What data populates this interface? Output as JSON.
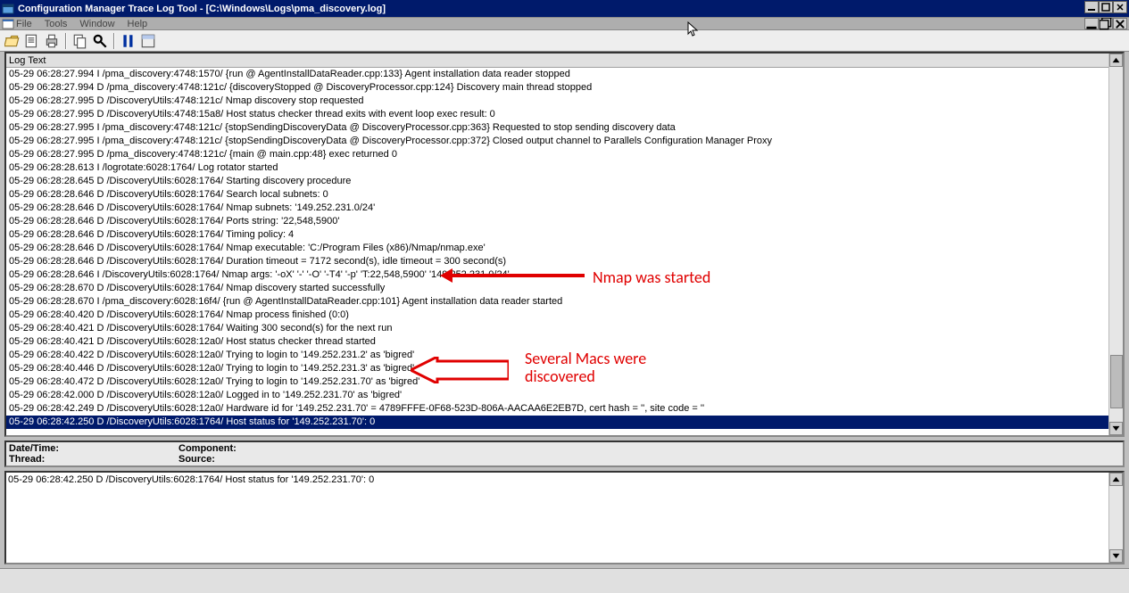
{
  "window": {
    "title": "Configuration Manager Trace Log Tool - [C:\\Windows\\Logs\\pma_discovery.log]"
  },
  "menu": {
    "file": "File",
    "tools": "Tools",
    "window": "Window",
    "help": "Help"
  },
  "toolbar_icons": {
    "open": "open-icon",
    "open_log": "open-folder-icon",
    "print": "print-icon",
    "copy": "copy-icon",
    "find": "find-icon",
    "pause": "pause-icon",
    "less": "single-pane-icon"
  },
  "list_header": "Log Text",
  "log_rows": [
    "05-29 06:28:27.994 I /pma_discovery:4748:1570/ {run @ AgentInstallDataReader.cpp:133} Agent installation data reader stopped",
    "05-29 06:28:27.994 D /pma_discovery:4748:121c/ {discoveryStopped @ DiscoveryProcessor.cpp:124} Discovery main thread stopped",
    "05-29 06:28:27.995 D /DiscoveryUtils:4748:121c/ Nmap discovery stop requested",
    "05-29 06:28:27.995 D /DiscoveryUtils:4748:15a8/ Host status checker thread exits with event loop exec result: 0",
    "05-29 06:28:27.995 I /pma_discovery:4748:121c/ {stopSendingDiscoveryData @ DiscoveryProcessor.cpp:363} Requested to stop sending discovery data",
    "05-29 06:28:27.995 I /pma_discovery:4748:121c/ {stopSendingDiscoveryData @ DiscoveryProcessor.cpp:372} Closed output channel to Parallels Configuration Manager Proxy",
    "05-29 06:28:27.995 D /pma_discovery:4748:121c/ {main @ main.cpp:48} exec returned 0",
    "05-29 06:28:28.613 I /logrotate:6028:1764/ Log rotator started",
    "05-29 06:28:28.645 D /DiscoveryUtils:6028:1764/ Starting discovery procedure",
    "05-29 06:28:28.646 D /DiscoveryUtils:6028:1764/ Search local subnets: 0",
    "05-29 06:28:28.646 D /DiscoveryUtils:6028:1764/ Nmap subnets: '149.252.231.0/24'",
    "05-29 06:28:28.646 D /DiscoveryUtils:6028:1764/ Ports string: '22,548,5900'",
    "05-29 06:28:28.646 D /DiscoveryUtils:6028:1764/ Timing policy: 4",
    "05-29 06:28:28.646 D /DiscoveryUtils:6028:1764/ Nmap executable: 'C:/Program Files (x86)/Nmap/nmap.exe'",
    "05-29 06:28:28.646 D /DiscoveryUtils:6028:1764/ Duration timeout = 7172 second(s), idle timeout = 300 second(s)",
    "05-29 06:28:28.646 I /DiscoveryUtils:6028:1764/ Nmap args: '-oX' '-' '-O' '-T4' '-p' 'T:22,548,5900' '149.252.231.0/24'",
    "05-29 06:28:28.670 D /DiscoveryUtils:6028:1764/ Nmap discovery started successfully",
    "05-29 06:28:28.670 I /pma_discovery:6028:16f4/ {run @ AgentInstallDataReader.cpp:101} Agent installation data reader started",
    "05-29 06:28:40.420 D /DiscoveryUtils:6028:1764/ Nmap process finished (0:0)",
    "05-29 06:28:40.421 D /DiscoveryUtils:6028:1764/ Waiting 300 second(s) for the next run",
    "05-29 06:28:40.421 D /DiscoveryUtils:6028:12a0/ Host status checker thread started",
    "05-29 06:28:40.422 D /DiscoveryUtils:6028:12a0/ Trying to login to '149.252.231.2' as 'bigred'",
    "05-29 06:28:40.446 D /DiscoveryUtils:6028:12a0/ Trying to login to '149.252.231.3' as 'bigred'",
    "05-29 06:28:40.472 D /DiscoveryUtils:6028:12a0/ Trying to login to '149.252.231.70' as 'bigred'",
    "05-29 06:28:42.000 D /DiscoveryUtils:6028:12a0/ Logged in to '149.252.231.70' as 'bigred'",
    "05-29 06:28:42.249 D /DiscoveryUtils:6028:12a0/ Hardware id for '149.252.231.70' = 4789FFFE-0F68-523D-806A-AACAA6E2EB7D, cert hash = '', site code = ''",
    "05-29 06:28:42.250 D /DiscoveryUtils:6028:1764/ Host status for '149.252.231.70': 0"
  ],
  "selected_row_index": 26,
  "details": {
    "datetime_label": "Date/Time:",
    "component_label": "Component:",
    "thread_label": "Thread:",
    "source_label": "Source:"
  },
  "detail_text": "05-29 06:28:42.250 D /DiscoveryUtils:6028:1764/ Host status for '149.252.231.70': 0",
  "annotations": {
    "a1": "Nmap was started",
    "a2_l1": "Several Macs were",
    "a2_l2": "discovered"
  }
}
